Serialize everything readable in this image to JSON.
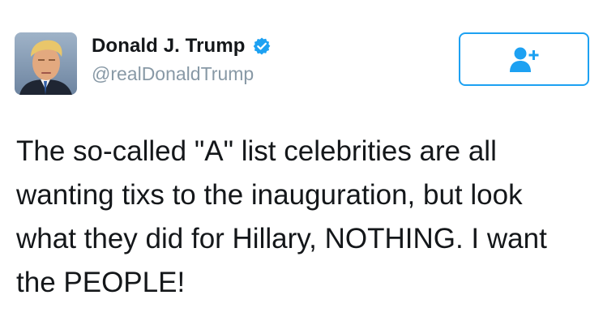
{
  "user": {
    "display_name": "Donald J. Trump",
    "handle": "@realDonaldTrump",
    "verified": true,
    "avatar_icon": "profile-photo"
  },
  "follow_button": {
    "icon": "add-user-icon"
  },
  "tweet": {
    "lines": [
      "The so-called \"A\" list celebrities are all",
      "wanting tixs to the inauguration, but look",
      "what they did for Hillary, NOTHING. I want",
      "the PEOPLE!"
    ]
  },
  "colors": {
    "accent": "#1da1f2",
    "text": "#14171a",
    "muted": "#8899a6"
  }
}
